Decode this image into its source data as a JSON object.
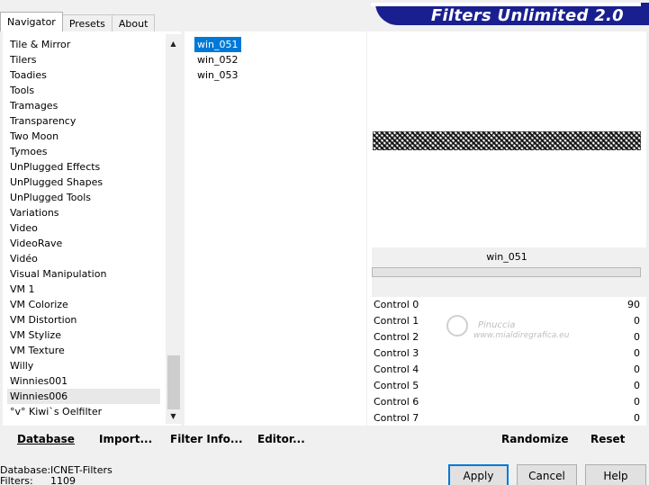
{
  "tabs": [
    {
      "label": "Navigator",
      "active": true
    },
    {
      "label": "Presets",
      "active": false
    },
    {
      "label": "About",
      "active": false
    }
  ],
  "banner": {
    "title": "Filters Unlimited 2.0",
    "color": "#1a1f8f"
  },
  "categories": {
    "items": [
      "Tile & Mirror",
      "Tilers",
      "Toadies",
      "Tools",
      "Tramages",
      "Transparency",
      "Two Moon",
      "Tymoes",
      "UnPlugged Effects",
      "UnPlugged Shapes",
      "UnPlugged Tools",
      "Variations",
      "Video",
      "VideoRave",
      "Vidéo",
      "Visual Manipulation",
      "VM 1",
      "VM Colorize",
      "VM Distortion",
      "VM Stylize",
      "VM Texture",
      "Willy",
      "Winnies001",
      "Winnies006",
      "°v° Kiwi`s Oelfilter"
    ],
    "selected": "Winnies006"
  },
  "filters": {
    "items": [
      "win_051",
      "win_052",
      "win_053"
    ],
    "selected": "win_051"
  },
  "preview": {
    "filter_name": "win_051",
    "controls": [
      {
        "label": "Control 0",
        "value": "90"
      },
      {
        "label": "Control 1",
        "value": "0"
      },
      {
        "label": "Control 2",
        "value": "0"
      },
      {
        "label": "Control 3",
        "value": "0"
      },
      {
        "label": "Control 4",
        "value": "0"
      },
      {
        "label": "Control 5",
        "value": "0"
      },
      {
        "label": "Control 6",
        "value": "0"
      },
      {
        "label": "Control 7",
        "value": "0"
      }
    ],
    "watermark": {
      "line1": "Pinuccia",
      "line2": "www.mialdiregrafica.eu"
    }
  },
  "toolbar": {
    "database": "Database",
    "import": "Import...",
    "filter_info": "Filter Info...",
    "editor": "Editor...",
    "randomize": "Randomize",
    "reset": "Reset"
  },
  "status": {
    "database_key": "Database:",
    "database_value": "ICNET-Filters",
    "filters_key": "Filters:",
    "filters_value": "1109"
  },
  "dialog": {
    "apply": "Apply",
    "cancel": "Cancel",
    "help": "Help"
  },
  "colors": {
    "selection": "#0078d7",
    "panel_bg": "#f0f0f0"
  }
}
